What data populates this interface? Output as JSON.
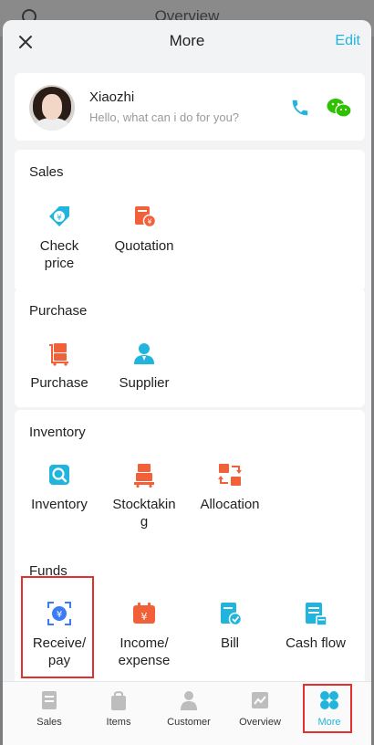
{
  "background": {
    "title": "Overview"
  },
  "header": {
    "title": "More",
    "edit_label": "Edit"
  },
  "assistant": {
    "name": "Xiaozhi",
    "subtitle": "Hello, what can i do for you?"
  },
  "sections": {
    "sales": {
      "title": "Sales",
      "items": [
        "Check\nprice",
        "Quotation"
      ]
    },
    "purchase": {
      "title": "Purchase",
      "items": [
        "Purchase",
        "Supplier"
      ]
    },
    "inventory": {
      "title": "Inventory",
      "items": [
        "Inventory",
        "Stocktakin\ng",
        "Allocation"
      ]
    },
    "funds": {
      "title": "Funds",
      "items": [
        "Receive/\npay",
        "Income/\nexpense",
        "Bill",
        "Cash flow"
      ]
    }
  },
  "bottom_nav": {
    "items": [
      "Sales",
      "Items",
      "Customer",
      "Overview",
      "More"
    ],
    "active": "More"
  },
  "colors": {
    "accent": "#21b5dd",
    "orange": "#f2603a",
    "highlight": "#e03030"
  }
}
